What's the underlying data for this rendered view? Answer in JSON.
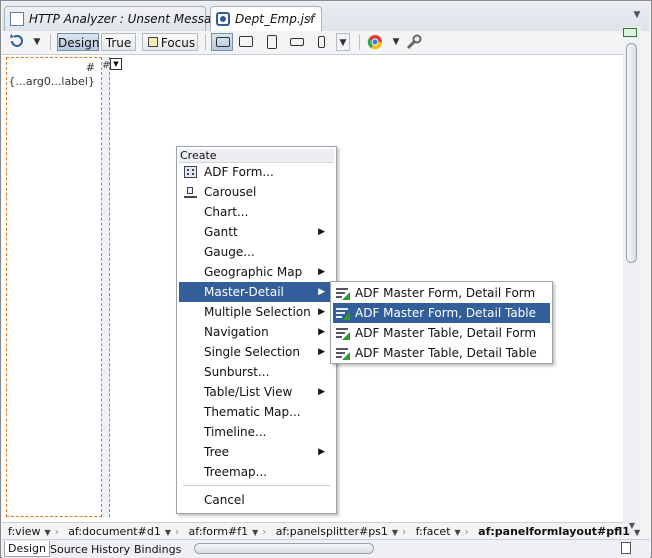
{
  "tabs": [
    {
      "label": "HTTP Analyzer : Unsent Message",
      "active": false
    },
    {
      "label": "Dept_Emp.jsf",
      "active": true
    }
  ],
  "tab_close_glyph": "×",
  "toolbar": {
    "design_label": "Design",
    "true_label": "True",
    "focus_label": "Focus",
    "device_buttons": [
      "desktop-icon",
      "tablet-landscape-icon",
      "tablet-portrait-icon",
      "phone-landscape-icon",
      "phone-portrait-icon"
    ],
    "browser_icon": "chrome-icon",
    "tools_icon": "wrench-icon"
  },
  "canvas": {
    "left_hash": "#",
    "left_label": "{...arg0...label}",
    "splitter_hash": "#"
  },
  "context_menu": {
    "header": "Create",
    "items": [
      {
        "label": "ADF Form...",
        "icon": "form-icon",
        "submenu": false
      },
      {
        "label": "Carousel",
        "icon": "carousel-icon",
        "submenu": false
      },
      {
        "label": "Chart...",
        "submenu": false
      },
      {
        "label": "Gantt",
        "submenu": true
      },
      {
        "label": "Gauge...",
        "submenu": false
      },
      {
        "label": "Geographic Map",
        "submenu": true
      },
      {
        "label": "Master-Detail",
        "submenu": true,
        "selected": true
      },
      {
        "label": "Multiple Selection",
        "submenu": true
      },
      {
        "label": "Navigation",
        "submenu": true
      },
      {
        "label": "Single Selection",
        "submenu": true
      },
      {
        "label": "Sunburst...",
        "submenu": false
      },
      {
        "label": "Table/List View",
        "submenu": true
      },
      {
        "label": "Thematic Map...",
        "submenu": false
      },
      {
        "label": "Timeline...",
        "submenu": false
      },
      {
        "label": "Tree",
        "submenu": true
      },
      {
        "label": "Treemap...",
        "submenu": false
      },
      {
        "label": "Cancel",
        "submenu": false
      }
    ]
  },
  "submenu": {
    "items": [
      {
        "label": "ADF Master Form, Detail Form",
        "selected": false
      },
      {
        "label": "ADF Master Form, Detail Table",
        "selected": true
      },
      {
        "label": "ADF Master Table, Detail Form",
        "selected": false
      },
      {
        "label": "ADF Master Table, Detail Table",
        "selected": false
      }
    ]
  },
  "breadcrumb": [
    "f:view",
    "af:document#d1",
    "af:form#f1",
    "af:panelsplitter#ps1",
    "f:facet",
    "af:panelformlayout#pfl1"
  ],
  "bottom_tabs": [
    {
      "label": "Design",
      "active": true
    },
    {
      "label": "Source",
      "active": false
    },
    {
      "label": "History",
      "active": false
    },
    {
      "label": "Bindings",
      "active": false
    }
  ],
  "colors": {
    "selection": "#325f9a",
    "dashed_border": "#e07a1a",
    "accent_green": "#2f9a2f"
  }
}
